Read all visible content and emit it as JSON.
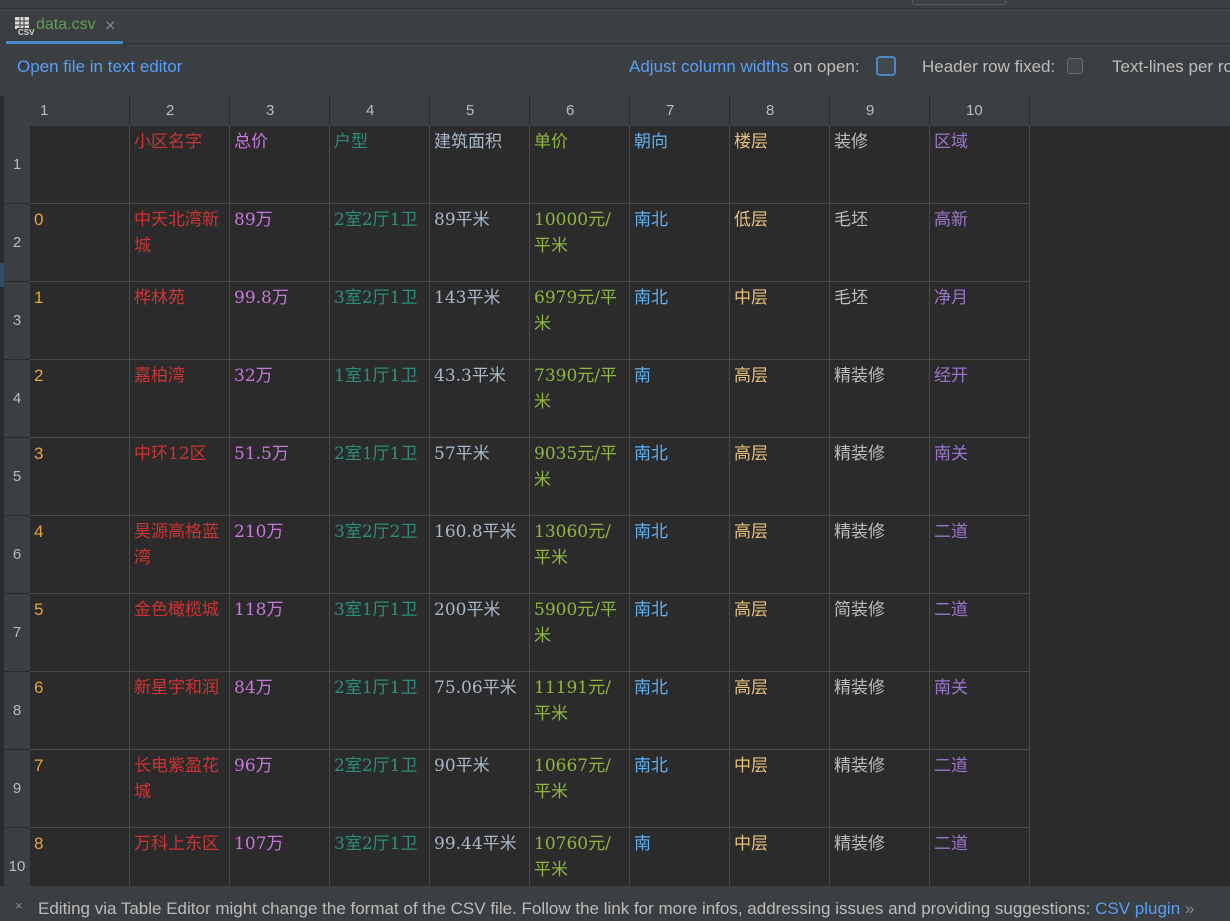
{
  "tab": {
    "title": "data.csv",
    "close_glyph": "×",
    "icon": "csv-file-icon"
  },
  "toolbar": {
    "open_link": "Open file in text editor",
    "adjust_link": "Adjust column widths",
    "adjust_suffix": " on open:",
    "header_label": "Header row fixed:",
    "textlines_label": "Text-lines per ro"
  },
  "columns": [
    "1",
    "2",
    "3",
    "4",
    "5",
    "6",
    "7",
    "8",
    "9",
    "10"
  ],
  "rows": [
    {
      "num": "1",
      "cells": [
        "",
        "小区名字",
        "总价",
        "户型",
        "建筑面积",
        "单价",
        "朝向",
        "楼层",
        "装修",
        "区域"
      ]
    },
    {
      "num": "2",
      "cells": [
        "0",
        "中天北湾新城",
        "89万",
        "2室2厅1卫",
        "89平米",
        "10000元/平米",
        "南北",
        "低层",
        "毛坯",
        "高新"
      ]
    },
    {
      "num": "3",
      "cells": [
        "1",
        "桦林苑",
        "99.8万",
        "3室2厅1卫",
        "143平米",
        "6979元/平米",
        "南北",
        "中层",
        "毛坯",
        "净月"
      ]
    },
    {
      "num": "4",
      "cells": [
        "2",
        "嘉柏湾",
        "32万",
        "1室1厅1卫",
        "43.3平米",
        "7390元/平米",
        "南",
        "高层",
        "精装修",
        "经开"
      ]
    },
    {
      "num": "5",
      "cells": [
        "3",
        "中环12区",
        "51.5万",
        "2室1厅1卫",
        "57平米",
        "9035元/平米",
        "南北",
        "高层",
        "精装修",
        "南关"
      ]
    },
    {
      "num": "6",
      "cells": [
        "4",
        "昊源高格蓝湾",
        "210万",
        "3室2厅2卫",
        "160.8平米",
        "13060元/平米",
        "南北",
        "高层",
        "精装修",
        "二道"
      ]
    },
    {
      "num": "7",
      "cells": [
        "5",
        "金色橄榄城",
        "118万",
        "3室1厅1卫",
        "200平米",
        "5900元/平米",
        "南北",
        "高层",
        "简装修",
        "二道"
      ]
    },
    {
      "num": "8",
      "cells": [
        "6",
        "新星宇和润",
        "84万",
        "2室1厅1卫",
        "75.06平米",
        "11191元/平米",
        "南北",
        "高层",
        "精装修",
        "南关"
      ]
    },
    {
      "num": "9",
      "cells": [
        "7",
        "长电紫盈花城",
        "96万",
        "2室2厅1卫",
        "90平米",
        "10667元/平米",
        "南北",
        "中层",
        "精装修",
        "二道"
      ]
    },
    {
      "num": "10",
      "cells": [
        "8",
        "万科上东区",
        "107万",
        "3室2厅1卫",
        "99.44平米",
        "10760元/平米",
        "南",
        "中层",
        "精装修",
        "二道"
      ]
    }
  ],
  "footer": {
    "close_glyph": "×",
    "message": "Editing via Table Editor might change the format of the CSV file. Follow the link for more infos, addressing issues and providing suggestions: ",
    "link": "CSV plugin",
    "chevron": "»"
  },
  "colors": {
    "accent": "#4a88c7",
    "link": "#589df6",
    "col_colors": [
      "#e8a33a",
      "#cc3333",
      "#c678dd",
      "#2a8f7a",
      "#a9b7c6",
      "#8fb63f",
      "#61afef",
      "#e5c07b",
      "#bbbbbb",
      "#9876cc"
    ]
  }
}
